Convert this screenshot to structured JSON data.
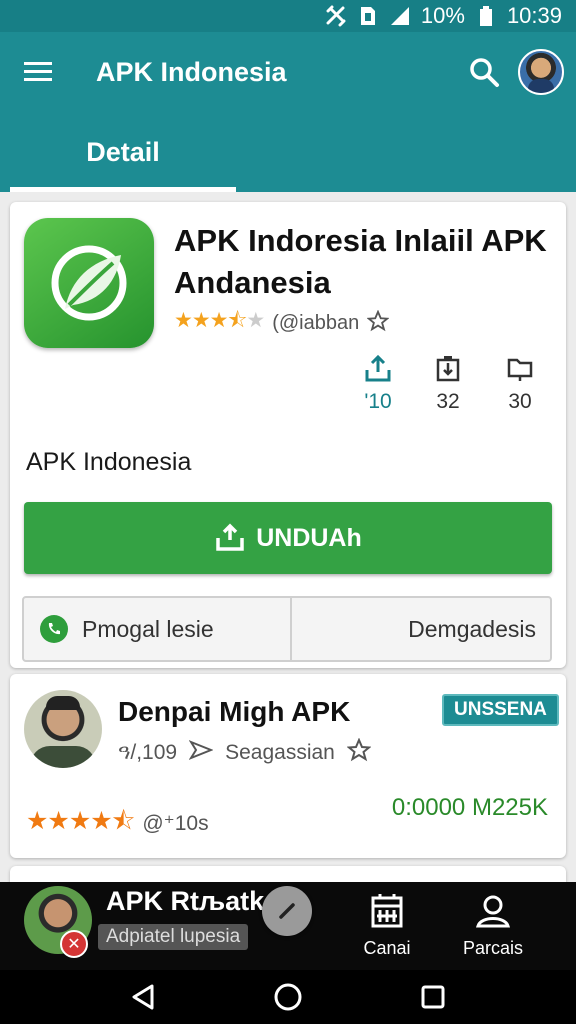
{
  "status_bar": {
    "battery": "10%",
    "time": "10:39",
    "icons": [
      "tools-icon",
      "sim-icon",
      "signal-icon",
      "battery-icon"
    ]
  },
  "app_bar": {
    "title": "APK Indonesia",
    "menu_icon": "menu-icon",
    "search_icon": "search-icon",
    "avatar": "profile-avatar"
  },
  "tabs": [
    {
      "label": "Detail",
      "active": true
    }
  ],
  "detail": {
    "app_name": "APK Indoresia Inlaiil APK Andanesia",
    "rating_stars": 3.5,
    "handle": "(@iabban",
    "stats": [
      {
        "icon": "upload-icon",
        "value": "'10"
      },
      {
        "icon": "battery-download-icon",
        "value": "32"
      },
      {
        "icon": "folder-icon",
        "value": "30"
      }
    ],
    "description": "APK Indonesia",
    "download_label": "UNDUAh",
    "split_left": "Pmogal lesie",
    "split_right": "Demgadesis"
  },
  "second": {
    "title": "Denpai Migh APK",
    "badge": "UNSSENA",
    "meta_left": "ዓ/,109",
    "meta_right": "Seagassian",
    "rating_stars": 4.5,
    "rating_count": "@⁺10s",
    "size": "0:0000 Μ225K"
  },
  "bottom_bar": {
    "title": "APK Rtљatk",
    "subtitle": "Adpiatel lupesia",
    "tab_a": "Canai",
    "tab_b": "Parcais"
  },
  "colors": {
    "teal": "#1d8c93",
    "green": "#34a244",
    "star": "#f4a21e"
  }
}
